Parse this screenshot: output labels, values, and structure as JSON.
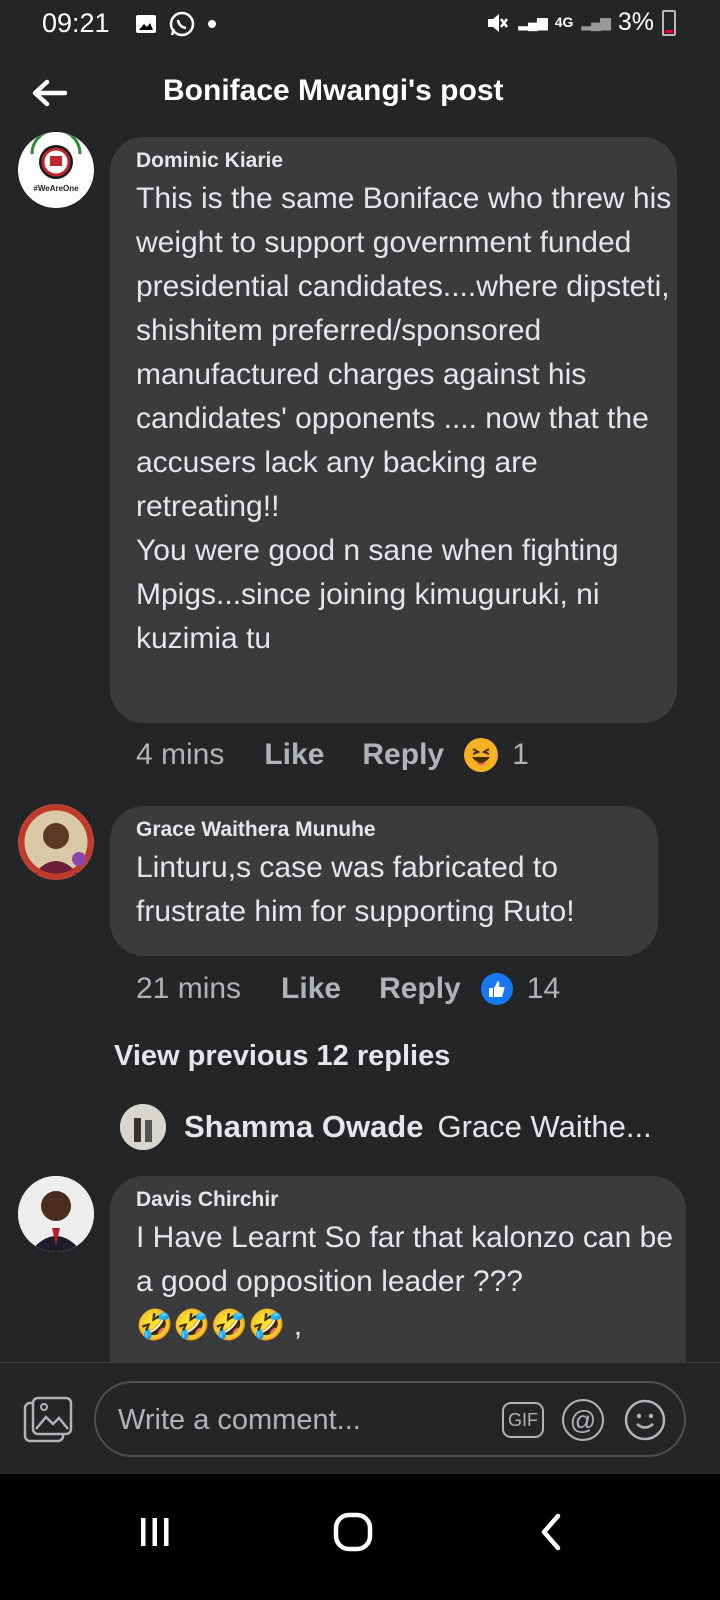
{
  "status_bar": {
    "time": "09:21",
    "network": "4G",
    "battery": "3%",
    "left_icons": [
      "gallery-icon",
      "whatsapp-icon",
      "dot-icon"
    ],
    "right_icons": [
      "mute-icon",
      "signal-icon",
      "signal-icon",
      "battery-icon"
    ]
  },
  "header": {
    "title": "Boniface Mwangi's post",
    "back_icon": "arrow-left-icon"
  },
  "comments": [
    {
      "author": "Dominic Kiarie",
      "text": "This is the same Boniface who threw his weight to support government funded presidential candidates....where dipsteti, shishitem preferred/sponsored manufactured charges against his candidates' opponents .... now that the accusers lack any backing are retreating!!\nYou were good n sane when fighting Mpigs...since joining kimuguruki, ni kuzimia tu",
      "time": "4 mins",
      "like_label": "Like",
      "reply_label": "Reply",
      "reaction_icon": "laughing-emoji-icon",
      "reaction_count": "1",
      "avatar_badge": "#WeAreOne"
    },
    {
      "author": "Grace Waithera Munuhe",
      "text": "Linturu,s case was fabricated to frustrate him for supporting Ruto!",
      "time": "21 mins",
      "like_label": "Like",
      "reply_label": "Reply",
      "reaction_icon": "thumbs-up-icon",
      "reaction_count": "14"
    },
    {
      "author": "Davis Chirchir",
      "text": "I Have Learnt So far that  kalonzo can be a good opposition leader ???",
      "emoji_line": "🤣🤣🤣🤣 ,"
    }
  ],
  "view_previous": "View previous 12 replies",
  "reply_preview": {
    "name": "Shamma Owade",
    "text": "Grace Waithe..."
  },
  "composer": {
    "placeholder": "Write a comment...",
    "gif_label": "GIF",
    "at_label": "@"
  },
  "navbar": {
    "icons": [
      "recent-apps-icon",
      "home-icon",
      "back-icon"
    ]
  },
  "colors": {
    "background": "#242526",
    "bubble": "#3a3b3c",
    "text": "#e4e6eb",
    "secondary_text": "#b0b3b8",
    "like_blue": "#1877f2",
    "reaction_yellow": "#f7b125"
  }
}
